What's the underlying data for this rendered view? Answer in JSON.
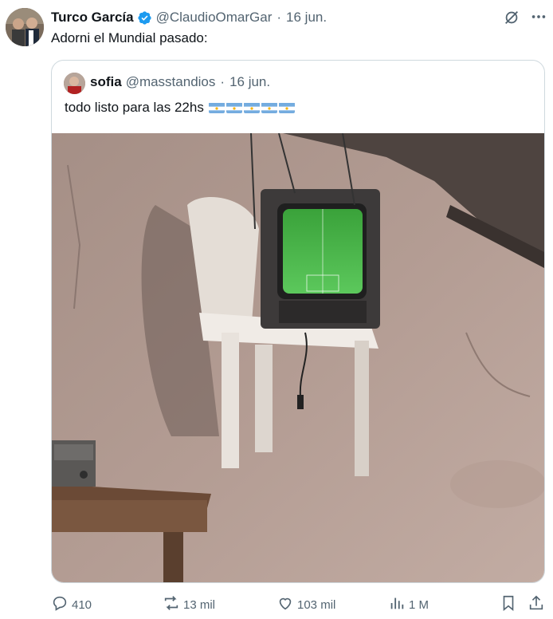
{
  "tweet": {
    "author_name": "Turco García",
    "handle": "@ClaudioOmarGar",
    "separator": "·",
    "date": "16 jun.",
    "text": "Adorni el Mundial pasado:"
  },
  "quoted": {
    "author_name": "sofia",
    "handle": "@masstandios",
    "separator": "·",
    "date": "16 jun.",
    "text": "todo listo para las 22hs",
    "emoji": [
      "argentina-flag",
      "argentina-flag",
      "argentina-flag",
      "argentina-flag",
      "argentina-flag"
    ]
  },
  "actions": {
    "replies": "410",
    "reposts": "13 mil",
    "likes": "103 mil",
    "views": "1 M"
  },
  "icons": [
    "verified-icon",
    "grok-icon",
    "more-icon",
    "reply-icon",
    "repost-icon",
    "like-icon",
    "views-icon",
    "bookmark-icon",
    "share-icon"
  ],
  "colors": {
    "verified": "#1d9bf0",
    "muted": "#536471",
    "border": "#cfd9de"
  }
}
